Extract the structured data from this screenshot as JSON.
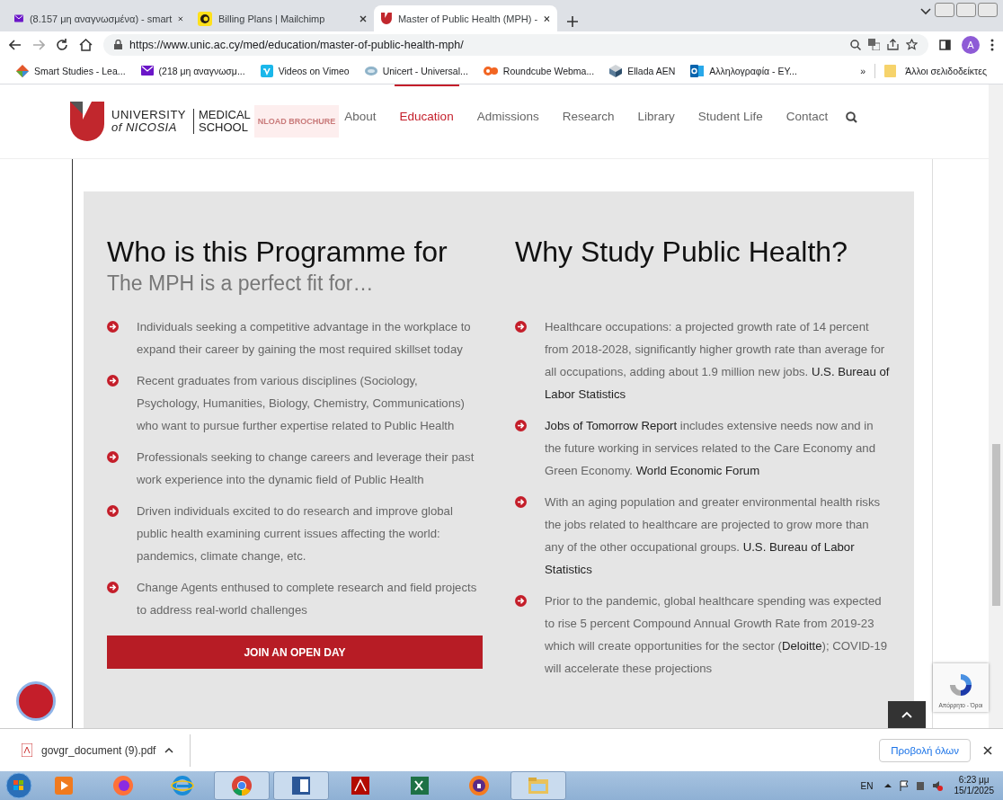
{
  "browser": {
    "tabs": [
      {
        "title": "(8.157 μη αναγνωσμένα) - smart",
        "kind": "mail",
        "selected": false
      },
      {
        "title": "Billing Plans | Mailchimp",
        "kind": "chimp",
        "selected": false
      },
      {
        "title": "Master of Public Health (MPH) -",
        "kind": "unic",
        "selected": true
      }
    ],
    "url": "https://www.unic.ac.cy/med/education/master-of-public-health-mph/",
    "profile": "A",
    "bookmarks": [
      {
        "label": "Smart Studies - Lea...",
        "kind": "puzzle"
      },
      {
        "label": "(218 μη αναγνωσμ...",
        "kind": "mail"
      },
      {
        "label": "Videos on Vimeo",
        "kind": "vimeo"
      },
      {
        "label": "Unicert - Universal...",
        "kind": "disc"
      },
      {
        "label": "Roundcube Webma...",
        "kind": "cp"
      },
      {
        "label": "Ellada AEN",
        "kind": "cube"
      },
      {
        "label": "Αλληλογραφία - ΕΥ...",
        "kind": "outlook"
      }
    ],
    "more": "»",
    "other_bookmarks": "Άλλοι σελιδοδείκτες"
  },
  "site": {
    "logo": {
      "line1": "UNIVERSITY",
      "line2": "of NICOSIA",
      "school1": "MEDICAL",
      "school2": "SCHOOL"
    },
    "brochure": "NLOAD BROCHURE",
    "nav": [
      {
        "label": "About",
        "selected": false
      },
      {
        "label": "Education",
        "selected": true
      },
      {
        "label": "Admissions",
        "selected": false
      },
      {
        "label": "Research",
        "selected": false
      },
      {
        "label": "Library",
        "selected": false
      },
      {
        "label": "Student Life",
        "selected": false
      },
      {
        "label": "Contact",
        "selected": false
      }
    ],
    "left": {
      "title": "Who is this Programme for",
      "subtitle": "The MPH is a perfect fit for…",
      "items": [
        "Individuals seeking a competitive advantage in the workplace to expand their career by gaining the most required skillset today",
        "Recent graduates from various disciplines (Sociology, Psychology, Humanities, Biology, Chemistry, Communications) who want to pursue further expertise related to Public Health",
        "Professionals seeking to change careers and leverage their past work experience into the dynamic field of Public Health",
        "Driven individuals excited to do research and improve global public health examining current issues affecting the world: pandemics, climate change, etc.",
        "Change Agents enthused to complete research and field projects to address real-world challenges"
      ],
      "button": "JOIN AN OPEN DAY"
    },
    "right": {
      "title": "Why Study Public Health?",
      "items": [
        "Healthcare occupations: a projected growth rate of 14 percent from 2018-2028, significantly higher growth rate than average for all occupations, adding about 1.9 million new jobs. **U.S. Bureau of Labor Statistics**",
        "**Jobs of Tomorrow Report** includes extensive needs now and in the future working in services related to the Care Economy and Green Economy. **World Economic Forum**",
        "With an aging population and greater environmental health risks the jobs related to healthcare are projected to grow more than any of the other occupational groups. **U.S. Bureau of Labor Statistics**",
        "Prior to the pandemic, global healthcare spending was expected to rise 5 percent Compound Annual Growth Rate from 2019-23 which will create opportunities for the sector (**Deloitte**); COVID-19 will accelerate these projections"
      ]
    },
    "recaptcha": "Απόρρητο - Όροι"
  },
  "downloads": {
    "file": "govgr_document (9).pdf",
    "show_all": "Προβολή όλων"
  },
  "taskbar": {
    "apps": [
      {
        "kind": "media",
        "open": false
      },
      {
        "kind": "firefox",
        "open": false
      },
      {
        "kind": "ie",
        "open": false
      },
      {
        "kind": "chrome",
        "open": true
      },
      {
        "kind": "word",
        "open": true
      },
      {
        "kind": "acrobat",
        "open": false
      },
      {
        "kind": "excel",
        "open": false
      },
      {
        "kind": "shield",
        "open": false
      },
      {
        "kind": "folder",
        "open": true
      }
    ],
    "lang": "EN",
    "time": "6:23 μμ",
    "date": "15/1/2025"
  }
}
